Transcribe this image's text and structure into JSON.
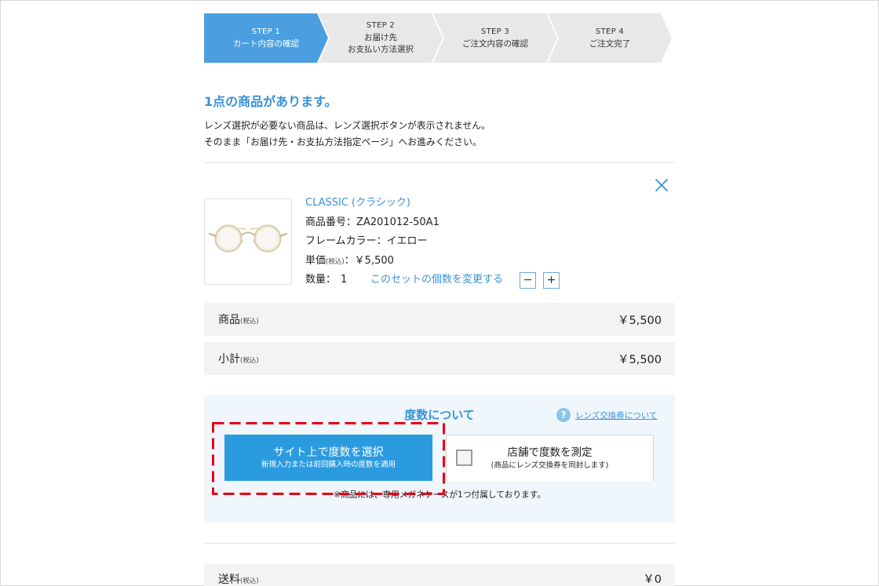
{
  "steps": [
    {
      "step": "STEP 1",
      "lines": [
        "カート内容の確認"
      ],
      "active": true
    },
    {
      "step": "STEP 2",
      "lines": [
        "お届け先",
        "お支払い方法選択"
      ],
      "active": false
    },
    {
      "step": "STEP 3",
      "lines": [
        "ご注文内容の確認"
      ],
      "active": false
    },
    {
      "step": "STEP 4",
      "lines": [
        "ご注文完了"
      ],
      "active": false
    }
  ],
  "cart": {
    "heading": "1点の商品があります。",
    "notice": [
      "レンズ選択が必要ない商品は、レンズ選択ボタンが表示されません。",
      "そのまま「お届け先・お支払方法指定ページ」へお進みください。"
    ]
  },
  "product": {
    "name": "CLASSIC (クラシック)",
    "sku_label": "商品番号：",
    "sku": "ZA201012-50A1",
    "color_label": "フレームカラー：",
    "color": "イエロー",
    "price_label": "単価",
    "tax_note": "(税込)",
    "price_colon": "：",
    "price": "￥5,500",
    "qty_label": "数量：",
    "qty": "1",
    "change_qty_link": "このセットの個数を変更する",
    "minus": "−",
    "plus": "+"
  },
  "summary": [
    {
      "label": "商品",
      "tax_note": "(税込)",
      "amount": "￥5,500"
    },
    {
      "label": "小計",
      "tax_note": "(税込)",
      "amount": "￥5,500"
    }
  ],
  "lens": {
    "title": "度数について",
    "help_icon_glyph": "?",
    "help_link": "レンズ交換券について",
    "online": {
      "title": "サイト上で度数を選択",
      "subtitle": "新規入力または前回購入時の度数を適用"
    },
    "store": {
      "title": "店舗で度数を測定",
      "subtitle": "(商品にレンズ交換券を同封します)",
      "checked": false
    },
    "note": "※商品には、専用メガネケースが1つ付属しております。"
  },
  "shipping": {
    "label": "送料",
    "tax_note": "(税込)",
    "amount": "￥0"
  },
  "icons": {
    "remove": "close-icon",
    "help": "question-circle-icon",
    "product_image": "glasses-icon",
    "store_option": "checkbox-icon"
  },
  "colors": {
    "accent": "#3a92d6",
    "step_active": "#4b9fe1",
    "step_inactive": "#e8e8e8",
    "primary_button": "#2b9be0",
    "panel": "#eff6fc",
    "row": "#f3f3f3",
    "highlight": "#e60012"
  }
}
